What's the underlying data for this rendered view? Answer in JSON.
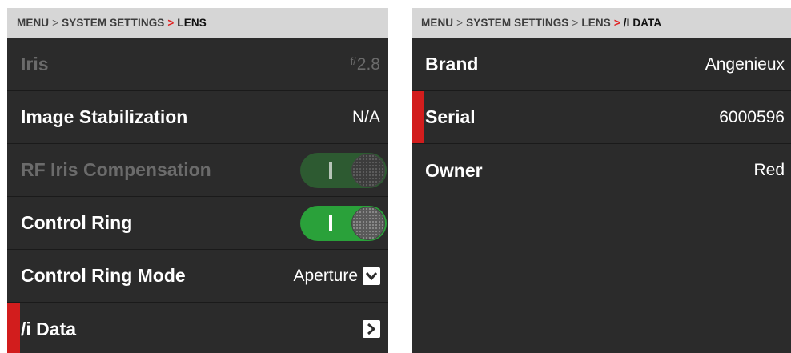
{
  "left": {
    "breadcrumb": {
      "items": [
        "MENU",
        "SYSTEM SETTINGS",
        "LENS"
      ],
      "separator": ">"
    },
    "rows": [
      {
        "label": "Iris",
        "value_prefix": "f/",
        "value": "2.8",
        "disabled": true
      },
      {
        "label": "Image Stabilization",
        "value": "N/A"
      },
      {
        "label": "RF Iris Compensation",
        "toggle": "on",
        "disabled": true
      },
      {
        "label": "Control Ring",
        "toggle": "on"
      },
      {
        "label": "Control Ring Mode",
        "value": "Aperture",
        "icon": "dropdown-icon"
      },
      {
        "label": "/i Data",
        "icon": "chevron-right-icon",
        "selected": true
      }
    ]
  },
  "right": {
    "breadcrumb": {
      "items": [
        "MENU",
        "SYSTEM SETTINGS",
        "LENS",
        "/I DATA"
      ],
      "separator": ">"
    },
    "rows": [
      {
        "label": "Brand",
        "value": "Angenieux"
      },
      {
        "label": "Serial",
        "value": "6000596",
        "selected": true
      },
      {
        "label": "Owner",
        "value": "Red"
      }
    ]
  },
  "colors": {
    "background": "#2b2b2b",
    "breadcrumb_bg": "#d6d6d6",
    "accent_red": "#d21d1d",
    "toggle_green": "#2aa13a"
  }
}
